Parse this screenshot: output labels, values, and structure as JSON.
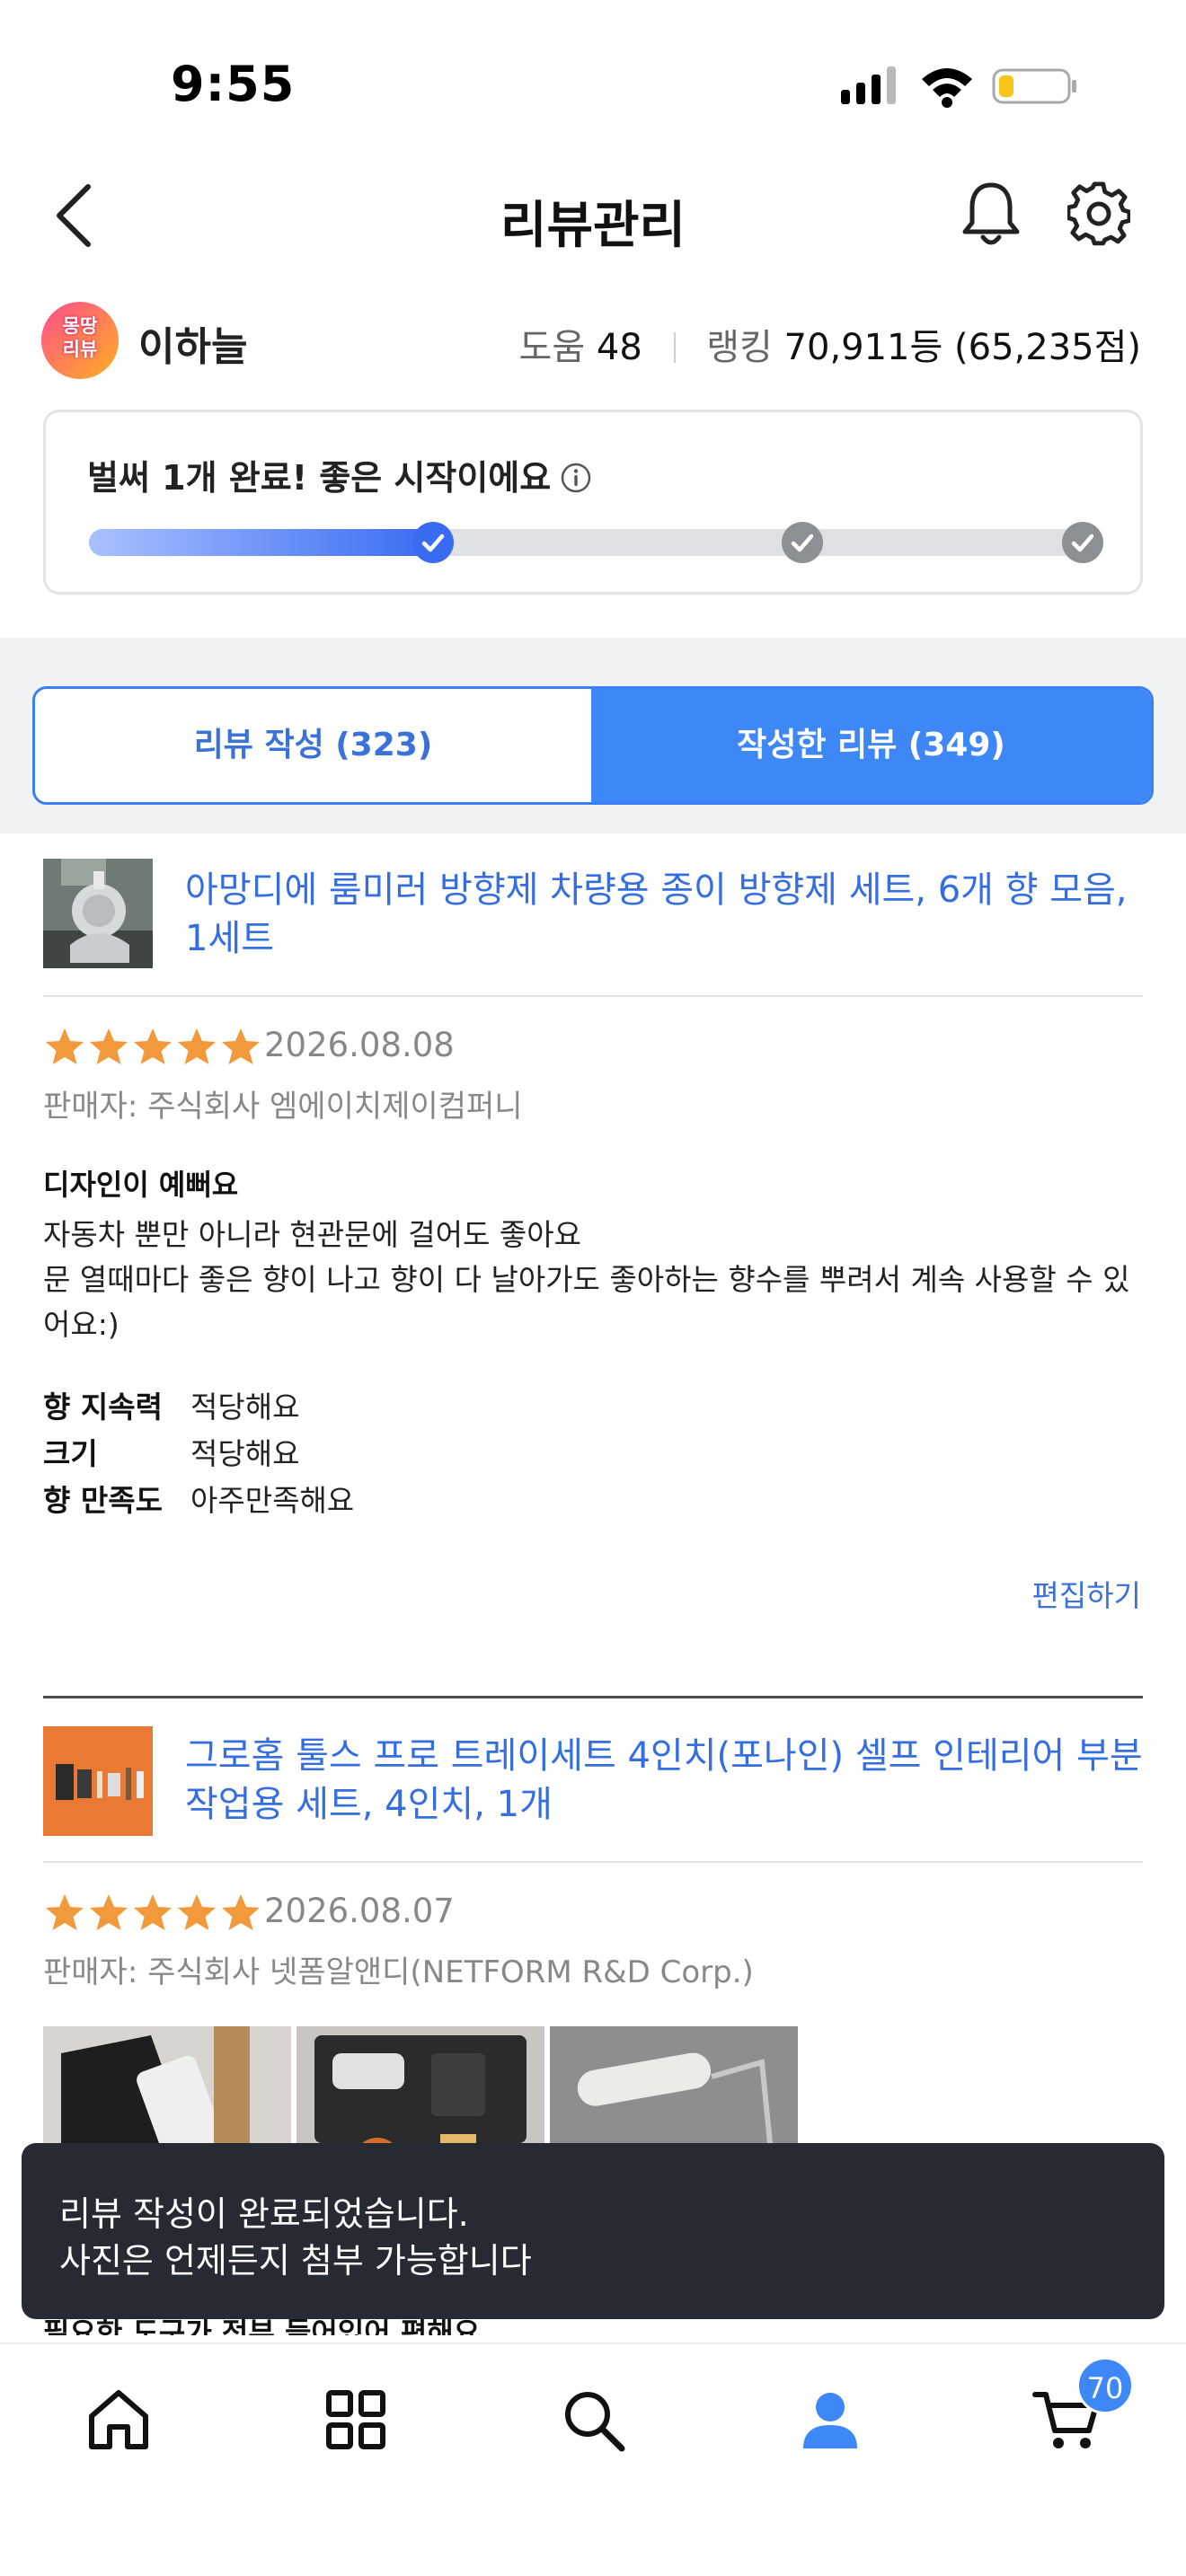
{
  "status_bar": {
    "time": "9:55"
  },
  "header": {
    "title": "리뷰관리"
  },
  "profile": {
    "name": "이하늘",
    "avatar_text": "몽땅\n리뷰",
    "help_label": "도움",
    "help_count": "48",
    "ranking_label": "랭킹",
    "ranking_value": "70,911등 (65,235점)"
  },
  "progress": {
    "message": "벌써 1개 완료! 좋은 시작이에요",
    "completed_steps": 1,
    "total_steps": 3,
    "fill_fraction": 0.34,
    "colors": {
      "active": "#3a6cf2",
      "inactive": "#8c8f94"
    }
  },
  "tabs": [
    {
      "label": "리뷰 작성 (323)",
      "selected": false
    },
    {
      "label": "작성한 리뷰 (349)",
      "selected": true
    }
  ],
  "reviews": [
    {
      "product_title": "아망디에 룸미러 방향제 차량용 종이 방향제 세트, 6개 향 모음, 1세트",
      "rating": 5,
      "date": "2026.08.08",
      "seller": "판매자: 주식회사 엠에이치제이컴퍼니",
      "headline": "디자인이 예뻐요",
      "body_line1": "자동차 뿐만 아니라 현관문에 걸어도 좋아요",
      "body_line2": "문 열때마다 좋은 향이 나고 향이 다 날아가도 좋아하는 향수를 뿌려서 계속 사용할 수 있어요:)",
      "attributes": [
        {
          "key": "향 지속력",
          "value": "적당해요"
        },
        {
          "key": "크기",
          "value": "적당해요"
        },
        {
          "key": "향 만족도",
          "value": "아주만족해요"
        }
      ],
      "edit_label": "편집하기"
    },
    {
      "product_title": "그로홈 툴스 프로 트레이세트 4인치(포나인) 셀프 인테리어 부분 작업용 세트, 4인치, 1개",
      "rating": 5,
      "date": "2026.08.07",
      "seller": "판매자: 주식회사 넷폼알앤디(NETFORM R&D Corp.)",
      "peek_text": "필요한 도구가 전부 들어있어 편해요"
    }
  ],
  "toast": {
    "line1": "리뷰 작성이 완료되었습니다.",
    "line2": "사진은 언제든지 첨부 가능합니다"
  },
  "bottom_nav": {
    "items": [
      "home-icon",
      "category-grid-icon",
      "search-icon",
      "user-icon",
      "cart-icon"
    ],
    "active": "user-icon",
    "cart_count": "70",
    "colors": {
      "active": "#3d87f7",
      "inactive": "#111111"
    }
  }
}
